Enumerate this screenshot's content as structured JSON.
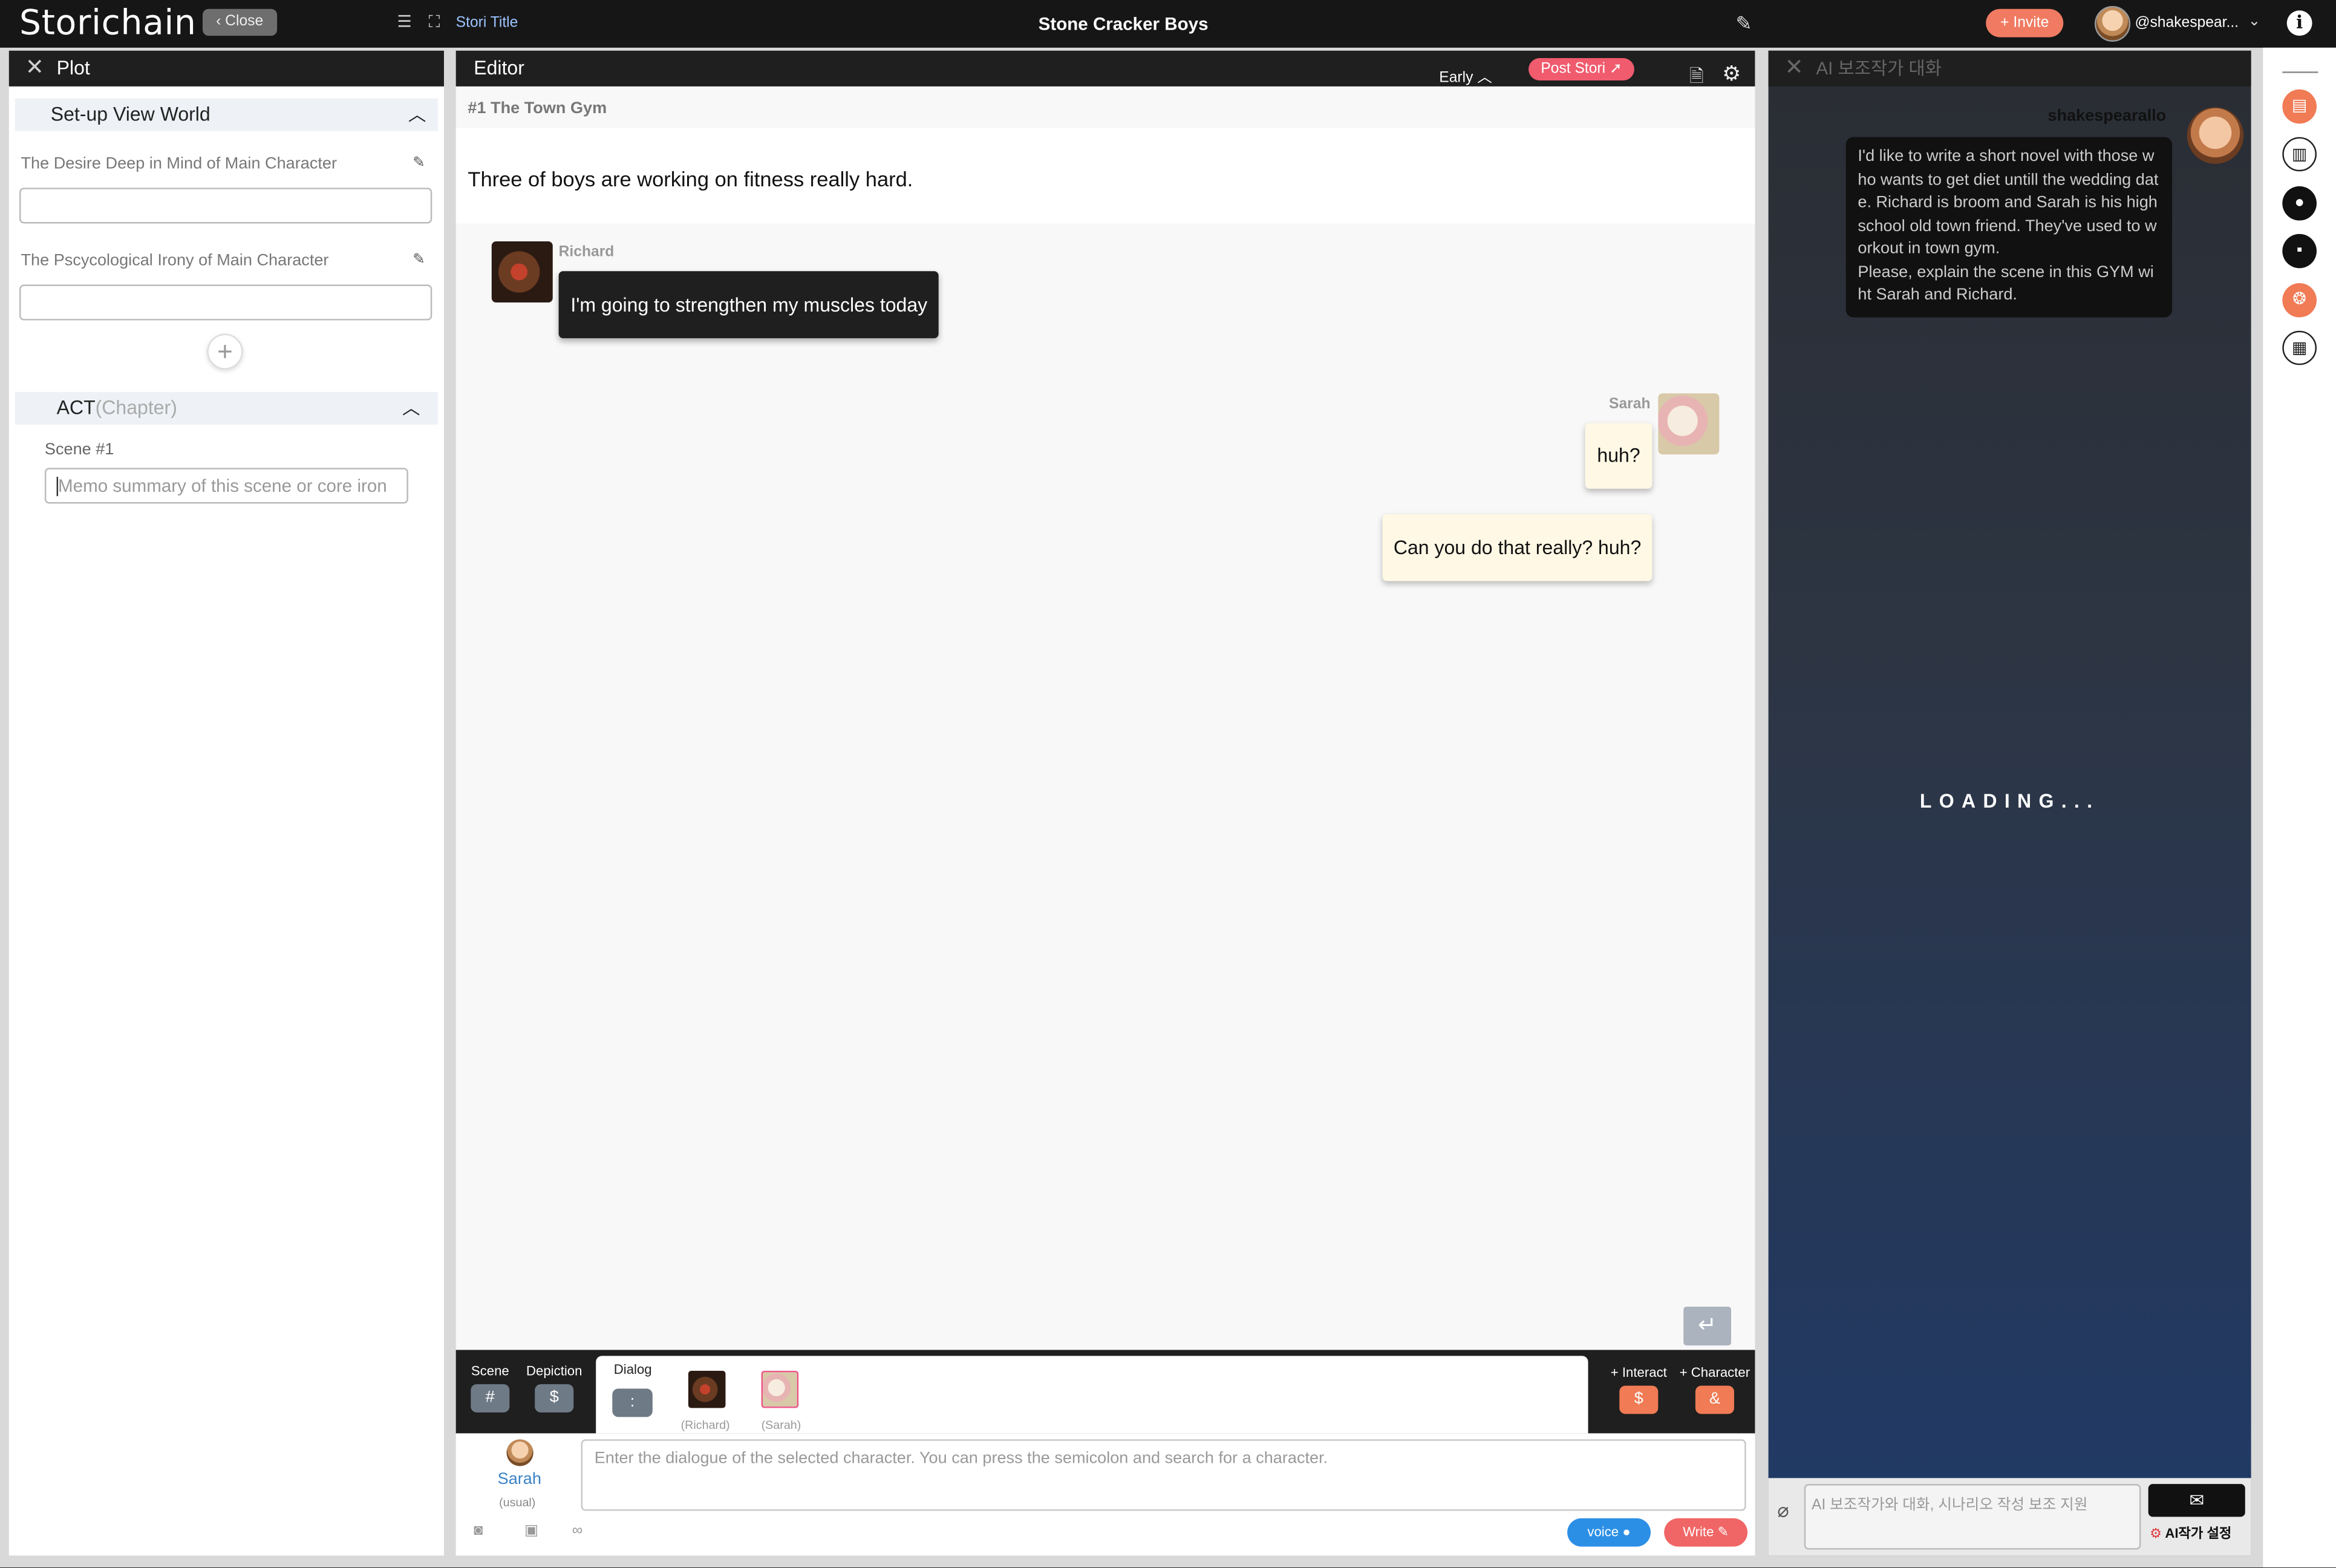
{
  "app": {
    "logo": "Storichain",
    "close_label": "Close",
    "stori_title_label": "Stori Title",
    "story_title": "Stone Cracker Boys",
    "invite_label": "+ Invite",
    "username": "@shakespear..."
  },
  "plot": {
    "title": "Plot",
    "setup_section": "Set-up View World",
    "field1_label": "The Desire Deep in Mind of Main Character",
    "field2_label": "The Pscycological Irony of Main Character",
    "act_label": "ACT",
    "act_muted": "(Chapter)",
    "scene_label": "Scene #1",
    "memo_placeholder": "Memo summary of this scene or core iron"
  },
  "editor": {
    "title": "Editor",
    "early_label": "Early",
    "post_label": "Post Stori",
    "scene_title": "#1 The Town Gym",
    "depiction": "Three of boys are working on fitness really hard.",
    "messages": [
      {
        "speaker": "Richard",
        "text": "I'm going to strengthen my muscles today"
      },
      {
        "speaker": "Sarah",
        "text": "huh?"
      },
      {
        "speaker": "",
        "text": "Can you do that really? huh?"
      }
    ],
    "tools": {
      "scene_label": "Scene",
      "scene_symbol": "#",
      "depiction_label": "Depiction",
      "depiction_symbol": "$",
      "dialog_label": "Dialog",
      "dialog_symbol": ":",
      "char1_name": "(Richard)",
      "char2_name": "(Sarah)",
      "interact_label": "+ Interact",
      "interact_symbol": "$",
      "character_label": "+ Character",
      "character_symbol": "&"
    },
    "selected_character": "Sarah",
    "selected_mood": "(usual)",
    "dialog_placeholder": "Enter the dialogue of the selected character. You can press the semicolon and search for a character.",
    "voice_label": "voice",
    "write_label": "Write"
  },
  "ai": {
    "title": "AI 보조작가 대화",
    "username": "shakespearallo",
    "prompt": "I'd like to write a short novel with those who wants to get diet untill the wedding date. Richard is broom and Sarah is his high school old town friend. They've used to workout in town gym.\nPlease, explain the scene in this GYM wiht Sarah and Richard.",
    "loading": "LOADING...",
    "input_placeholder": "AI 보조작가와 대화, 시나리오 작성 보조 지원",
    "settings_label": "AI작가 설정"
  },
  "colors": {
    "accent_red": "#f05b6e",
    "accent_orange": "#f07b55",
    "voice_blue": "#2c8fe6",
    "dark": "#1f1f1f"
  },
  "icons": [
    "close-icon",
    "pencil-icon",
    "chevron-up-icon",
    "plus-icon",
    "gear-icon",
    "document-icon",
    "enter-icon",
    "camera-icon",
    "gallery-icon",
    "link-icon",
    "mic-icon",
    "paperclip-icon",
    "mail-icon",
    "info-icon"
  ]
}
